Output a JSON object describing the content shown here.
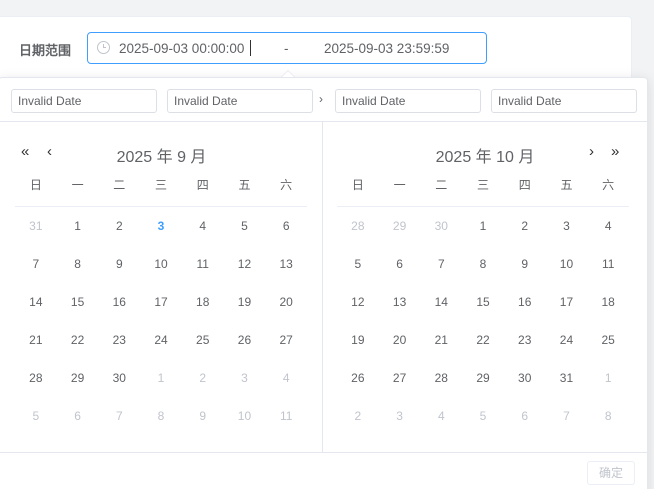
{
  "form": {
    "label": "日期范围",
    "start_value": "2025-09-03 00:00:00",
    "separator": "-",
    "end_value": "2025-09-03 23:59:59"
  },
  "picker": {
    "time_inputs": [
      "Invalid Date",
      "Invalid Date",
      "Invalid Date",
      "Invalid Date"
    ],
    "header_arrow": "›",
    "weekdays": [
      "日",
      "一",
      "二",
      "三",
      "四",
      "五",
      "六"
    ],
    "left": {
      "title": "2025 年 9 月",
      "prev_year": "«",
      "prev_month": "‹",
      "weeks": [
        [
          {
            "d": "31",
            "m": 1
          },
          {
            "d": "1"
          },
          {
            "d": "2"
          },
          {
            "d": "3",
            "t": 1
          },
          {
            "d": "4"
          },
          {
            "d": "5"
          },
          {
            "d": "6"
          }
        ],
        [
          {
            "d": "7"
          },
          {
            "d": "8"
          },
          {
            "d": "9"
          },
          {
            "d": "10"
          },
          {
            "d": "11"
          },
          {
            "d": "12"
          },
          {
            "d": "13"
          }
        ],
        [
          {
            "d": "14"
          },
          {
            "d": "15"
          },
          {
            "d": "16"
          },
          {
            "d": "17"
          },
          {
            "d": "18"
          },
          {
            "d": "19"
          },
          {
            "d": "20"
          }
        ],
        [
          {
            "d": "21"
          },
          {
            "d": "22"
          },
          {
            "d": "23"
          },
          {
            "d": "24"
          },
          {
            "d": "25"
          },
          {
            "d": "26"
          },
          {
            "d": "27"
          }
        ],
        [
          {
            "d": "28"
          },
          {
            "d": "29"
          },
          {
            "d": "30"
          },
          {
            "d": "1",
            "m": 1
          },
          {
            "d": "2",
            "m": 1
          },
          {
            "d": "3",
            "m": 1
          },
          {
            "d": "4",
            "m": 1
          }
        ],
        [
          {
            "d": "5",
            "m": 1
          },
          {
            "d": "6",
            "m": 1
          },
          {
            "d": "7",
            "m": 1
          },
          {
            "d": "8",
            "m": 1
          },
          {
            "d": "9",
            "m": 1
          },
          {
            "d": "10",
            "m": 1
          },
          {
            "d": "11",
            "m": 1
          }
        ]
      ]
    },
    "right": {
      "title": "2025 年 10 月",
      "next_month": "›",
      "next_year": "»",
      "weeks": [
        [
          {
            "d": "28",
            "m": 1
          },
          {
            "d": "29",
            "m": 1
          },
          {
            "d": "30",
            "m": 1
          },
          {
            "d": "1"
          },
          {
            "d": "2"
          },
          {
            "d": "3"
          },
          {
            "d": "4"
          }
        ],
        [
          {
            "d": "5"
          },
          {
            "d": "6"
          },
          {
            "d": "7"
          },
          {
            "d": "8"
          },
          {
            "d": "9"
          },
          {
            "d": "10"
          },
          {
            "d": "11"
          }
        ],
        [
          {
            "d": "12"
          },
          {
            "d": "13"
          },
          {
            "d": "14"
          },
          {
            "d": "15"
          },
          {
            "d": "16"
          },
          {
            "d": "17"
          },
          {
            "d": "18"
          }
        ],
        [
          {
            "d": "19"
          },
          {
            "d": "20"
          },
          {
            "d": "21"
          },
          {
            "d": "22"
          },
          {
            "d": "23"
          },
          {
            "d": "24"
          },
          {
            "d": "25"
          }
        ],
        [
          {
            "d": "26"
          },
          {
            "d": "27"
          },
          {
            "d": "28"
          },
          {
            "d": "29"
          },
          {
            "d": "30"
          },
          {
            "d": "31"
          },
          {
            "d": "1",
            "m": 1
          }
        ],
        [
          {
            "d": "2",
            "m": 1
          },
          {
            "d": "3",
            "m": 1
          },
          {
            "d": "4",
            "m": 1
          },
          {
            "d": "5",
            "m": 1
          },
          {
            "d": "6",
            "m": 1
          },
          {
            "d": "7",
            "m": 1
          },
          {
            "d": "8",
            "m": 1
          }
        ]
      ]
    },
    "confirm_label": "确定"
  },
  "colors": {
    "accent": "#409eff",
    "muted": "#c0c4cc",
    "text": "#606266"
  }
}
